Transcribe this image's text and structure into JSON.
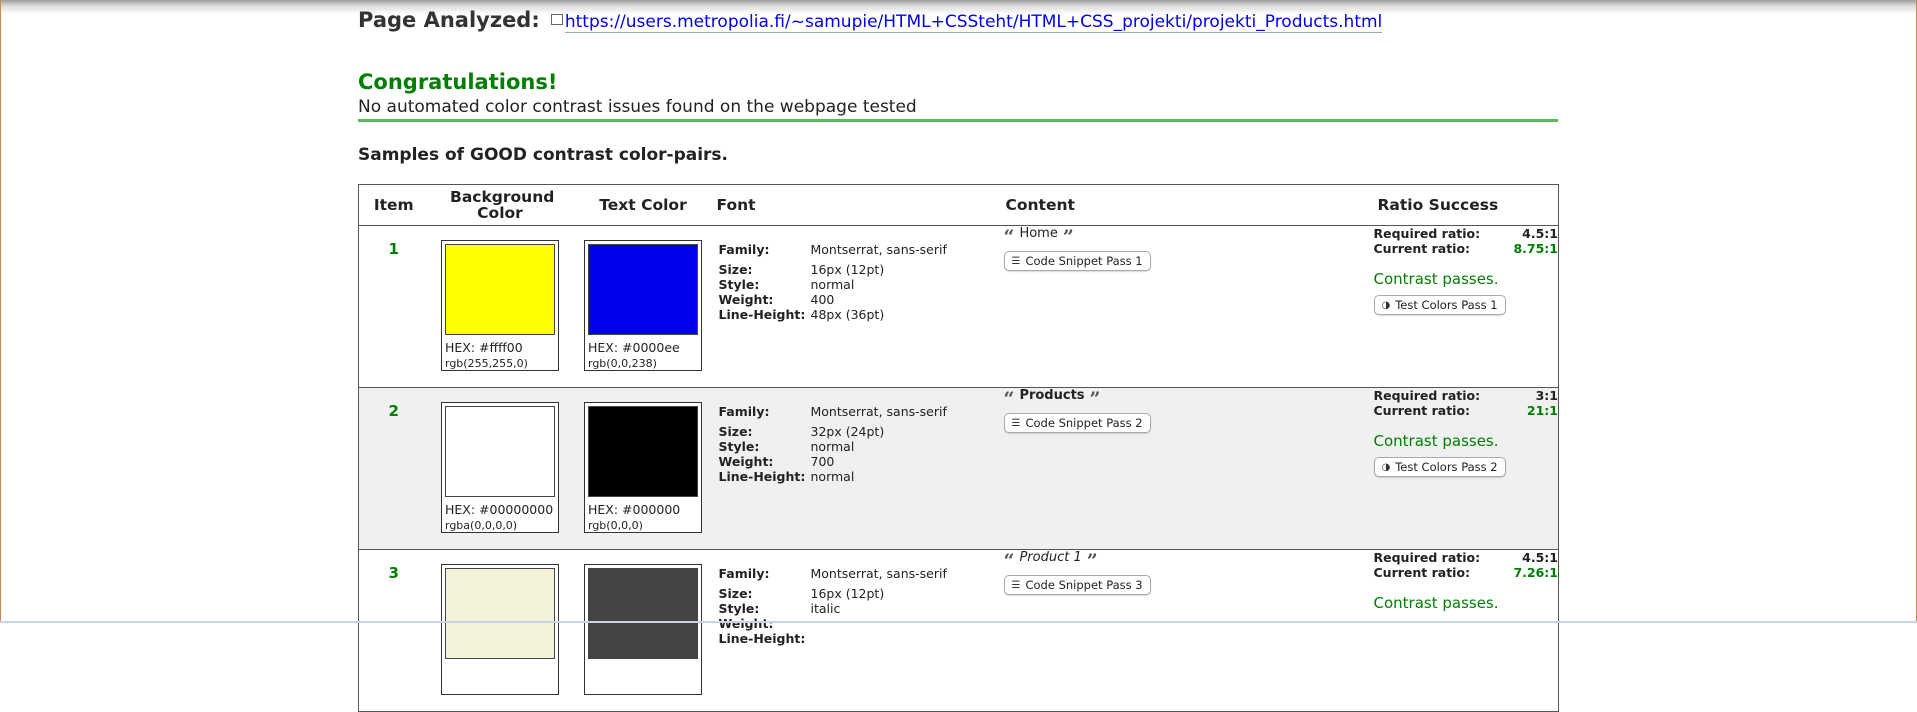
{
  "page_analyzed": {
    "label": "Page Analyzed:",
    "url": "https://users.metropolia.fi/~samupie/HTML+CSSteht/HTML+CSS_projekti/projekti_Products.html"
  },
  "congrats": "Congratulations!",
  "message": "No automated color contrast issues found on the webpage tested",
  "samples_heading": "Samples of GOOD contrast color-pairs.",
  "table": {
    "headers": {
      "item": "Item",
      "background_color": "Background Color",
      "text_color": "Text Color",
      "font": "Font",
      "content": "Content",
      "ratio_success": "Ratio Success"
    },
    "font_labels": {
      "family": "Family:",
      "size": "Size:",
      "style": "Style:",
      "weight": "Weight:",
      "line_height": "Line-Height:"
    },
    "ratio_labels": {
      "required": "Required ratio:",
      "current": "Current ratio:"
    },
    "rows": [
      {
        "item": "1",
        "bg": {
          "color": "#ffff00",
          "hex": "HEX: #ffff00",
          "rgb": "rgb(255,255,0)"
        },
        "text": {
          "color": "#0000ee",
          "hex": "HEX: #0000ee",
          "rgb": "rgb(0,0,238)"
        },
        "font": {
          "family": "Montserrat, sans-serif",
          "size": "16px (12pt)",
          "style": "normal",
          "weight": "400",
          "line_height": "48px (36pt)"
        },
        "content": {
          "text": "Home",
          "snippet_button": "Code Snippet Pass 1"
        },
        "ratio": {
          "required": "4.5:1",
          "current": "8.75:1",
          "result": "Contrast passes.",
          "test_button": "Test Colors Pass 1"
        }
      },
      {
        "item": "2",
        "bg": {
          "color": "#ffffff",
          "hex": "HEX: #00000000",
          "rgb": "rgba(0,0,0,0)"
        },
        "text": {
          "color": "#000000",
          "hex": "HEX: #000000",
          "rgb": "rgb(0,0,0)"
        },
        "font": {
          "family": "Montserrat, sans-serif",
          "size": "32px (24pt)",
          "style": "normal",
          "weight": "700",
          "line_height": "normal"
        },
        "content": {
          "text": "Products",
          "snippet_button": "Code Snippet Pass 2"
        },
        "ratio": {
          "required": "3:1",
          "current": "21:1",
          "result": "Contrast passes.",
          "test_button": "Test Colors Pass 2"
        }
      },
      {
        "item": "3",
        "bg": {
          "color": "#f2f3da",
          "hex": "",
          "rgb": ""
        },
        "text": {
          "color": "#444444",
          "hex": "",
          "rgb": ""
        },
        "font": {
          "family": "Montserrat, sans-serif",
          "size": "16px (12pt)",
          "style": "italic",
          "weight": "",
          "line_height": ""
        },
        "content": {
          "text": "Product 1",
          "snippet_button": "Code Snippet Pass 3"
        },
        "ratio": {
          "required": "4.5:1",
          "current": "7.26:1",
          "result": "Contrast passes.",
          "test_button": ""
        }
      }
    ]
  },
  "colors": {
    "pass_green": "#008000",
    "link_blue": "#0000ee",
    "rule_green": "#5cb85c",
    "alt_row": "#f0f0f0"
  },
  "icons": {
    "external_link": "external-link-icon",
    "open_quote": "open-quote-icon",
    "close_quote": "close-quote-icon",
    "code": "code-lines-icon",
    "contrast": "contrast-icon"
  }
}
